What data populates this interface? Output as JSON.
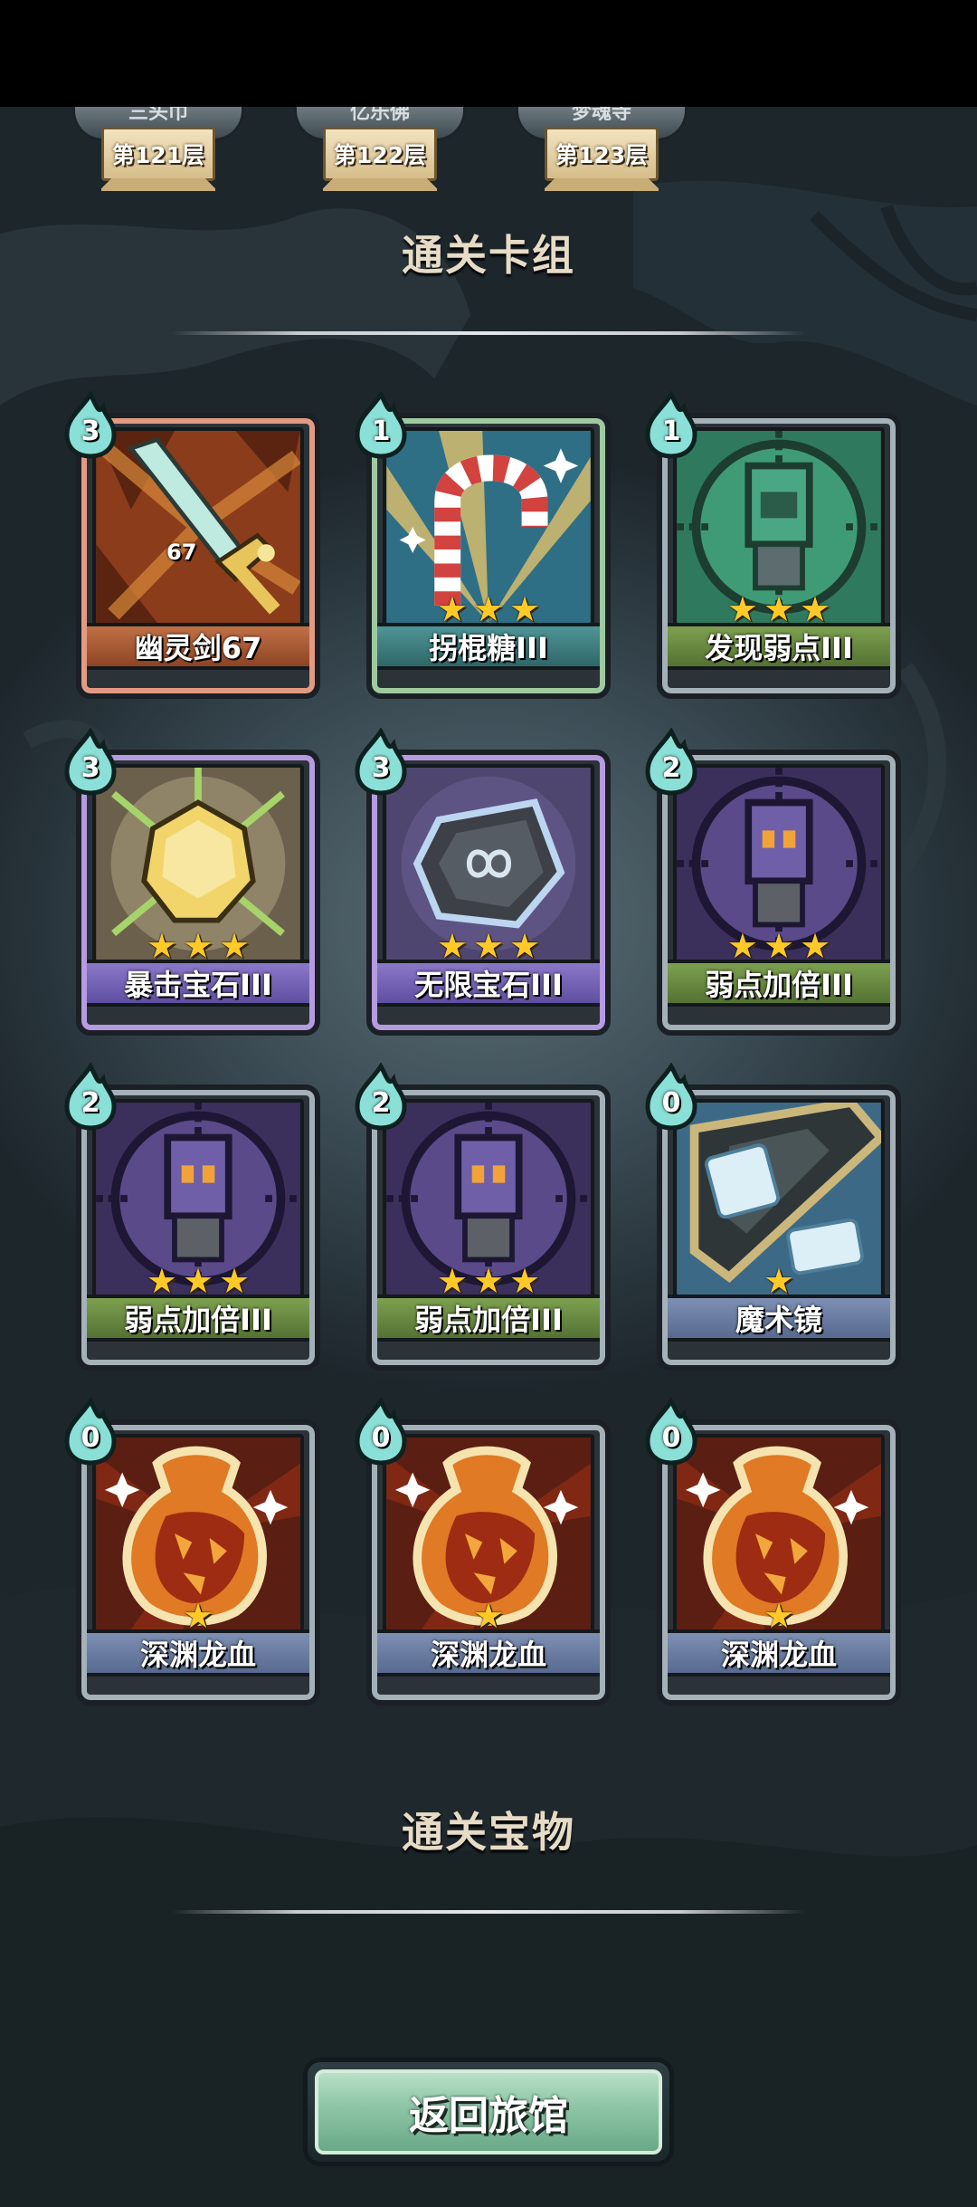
{
  "floors": [
    {
      "name": "三头巾",
      "floor": "第121层"
    },
    {
      "name": "亿乐佛",
      "floor": "第122层"
    },
    {
      "name": "梦魂寺",
      "floor": "第123层"
    }
  ],
  "deck_section": {
    "title": "通关卡组"
  },
  "cards": [
    {
      "name": "幽灵剑67",
      "cost": "3",
      "stars": 0,
      "level_tag": "67",
      "icon": "ghost-sword-icon"
    },
    {
      "name": "拐棍糖III",
      "cost": "1",
      "stars": 3,
      "icon": "candy-cane-icon"
    },
    {
      "name": "发现弱点III",
      "cost": "1",
      "stars": 3,
      "icon": "target-robot-icon"
    },
    {
      "name": "暴击宝石III",
      "cost": "3",
      "stars": 3,
      "icon": "crit-gem-icon"
    },
    {
      "name": "无限宝石III",
      "cost": "3",
      "stars": 3,
      "icon": "infinity-gem-icon"
    },
    {
      "name": "弱点加倍III",
      "cost": "2",
      "stars": 3,
      "icon": "target-robot-icon"
    },
    {
      "name": "弱点加倍III",
      "cost": "2",
      "stars": 3,
      "icon": "target-robot-icon"
    },
    {
      "name": "弱点加倍III",
      "cost": "2",
      "stars": 3,
      "icon": "target-robot-icon"
    },
    {
      "name": "魔术镜",
      "cost": "0",
      "stars": 1,
      "icon": "magic-mirror-icon"
    },
    {
      "name": "深渊龙血",
      "cost": "0",
      "stars": 1,
      "icon": "dragon-blood-icon"
    },
    {
      "name": "深渊龙血",
      "cost": "0",
      "stars": 1,
      "icon": "dragon-blood-icon"
    },
    {
      "name": "深渊龙血",
      "cost": "0",
      "stars": 1,
      "icon": "dragon-blood-icon"
    }
  ],
  "treasure_section": {
    "title": "通关宝物"
  },
  "return_button": {
    "label": "返回旅馆"
  }
}
